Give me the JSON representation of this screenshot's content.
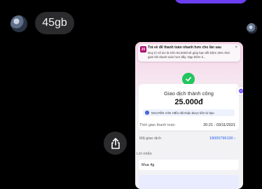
{
  "chat": {
    "message": "45gb"
  },
  "notification": {
    "title": "Trả về để thanh toán nhanh hơn cho lần sau",
    "body": "Duy trì số dư từ trên 50,000đ sẽ giúp bạn tiết kiệm 25% thời gian khi thanh toán hơn đấy. Nạp thêm ti..."
  },
  "receipt": {
    "status": "Giao dịch thành công",
    "amount": "25.000đ",
    "notice": "NGUYỄN VĂN HIẾU đã nhận được tiền từ bạn",
    "time_label": "Thời gian thanh toán",
    "time_value": "20:21 - 03/11/2021",
    "txn_label": "Mã giao dịch",
    "txn_value": "18000796100",
    "message_label": "Lời nhắn",
    "message_value": "Mua 4g"
  },
  "colors": {
    "accent": "#6b3ef0",
    "success": "#22c55e",
    "brand": "#b0006d"
  }
}
